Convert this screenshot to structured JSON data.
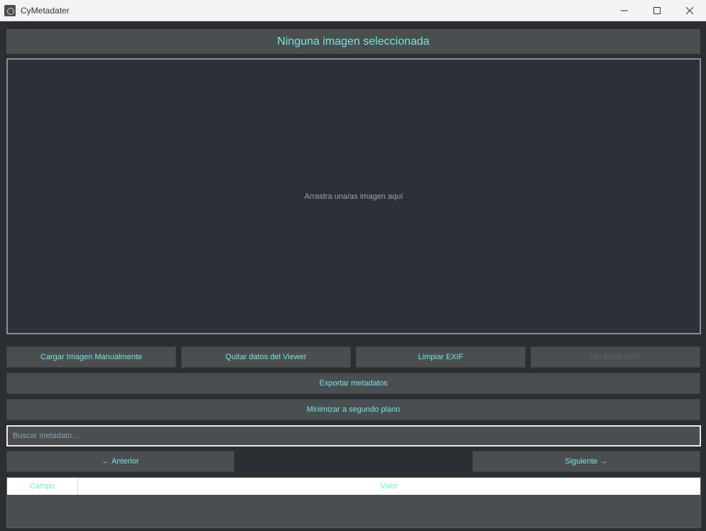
{
  "window": {
    "title": "CyMetadater"
  },
  "header": {
    "status": "Ninguna imagen seleccionada"
  },
  "dropzone": {
    "hint": "Arrastra una/as imagen aquí"
  },
  "actions": {
    "load": "Cargar Imagen Manualmente",
    "clear_viewer": "Quitar datos del Viewer",
    "clean_exif": "Limpiar EXIF",
    "gps": "Sin datos GPS",
    "export": "Exportar metadatos",
    "minimize": "Minimizar a segundo plano"
  },
  "search": {
    "placeholder": "Buscar metadato..."
  },
  "nav": {
    "prev": "← Anterior",
    "next": "Siguiente →"
  },
  "table": {
    "columns": [
      "Campo",
      "Valor"
    ],
    "rows": []
  },
  "colors": {
    "accent": "#6fe6e0",
    "background": "#2b2e33",
    "panel": "#4b4e51"
  }
}
